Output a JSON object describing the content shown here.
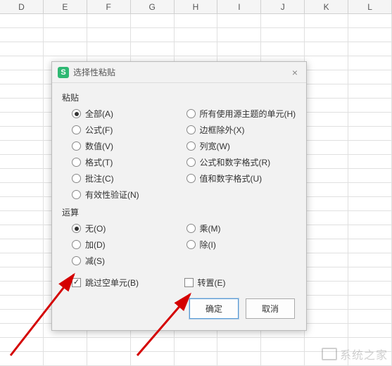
{
  "columns": [
    "D",
    "E",
    "F",
    "G",
    "H",
    "I",
    "J",
    "K",
    "L"
  ],
  "dialog": {
    "title": "选择性粘贴",
    "close": "×",
    "paste_group": "粘贴",
    "paste_options_left": [
      {
        "label": "全部(A)",
        "checked": true
      },
      {
        "label": "公式(F)",
        "checked": false
      },
      {
        "label": "数值(V)",
        "checked": false
      },
      {
        "label": "格式(T)",
        "checked": false
      },
      {
        "label": "批注(C)",
        "checked": false
      },
      {
        "label": "有效性验证(N)",
        "checked": false
      }
    ],
    "paste_options_right": [
      {
        "label": "所有使用源主题的单元(H)",
        "checked": false
      },
      {
        "label": "边框除外(X)",
        "checked": false
      },
      {
        "label": "列宽(W)",
        "checked": false
      },
      {
        "label": "公式和数字格式(R)",
        "checked": false
      },
      {
        "label": "值和数字格式(U)",
        "checked": false
      }
    ],
    "operation_group": "运算",
    "operation_left": [
      {
        "label": "无(O)",
        "checked": true
      },
      {
        "label": "加(D)",
        "checked": false
      },
      {
        "label": "减(S)",
        "checked": false
      }
    ],
    "operation_right": [
      {
        "label": "乘(M)",
        "checked": false
      },
      {
        "label": "除(I)",
        "checked": false
      }
    ],
    "skip_blanks": {
      "label": "跳过空单元(B)",
      "checked": true
    },
    "transpose": {
      "label": "转置(E)",
      "checked": false
    },
    "ok": "确定",
    "cancel": "取消"
  },
  "watermark": "系统之家"
}
